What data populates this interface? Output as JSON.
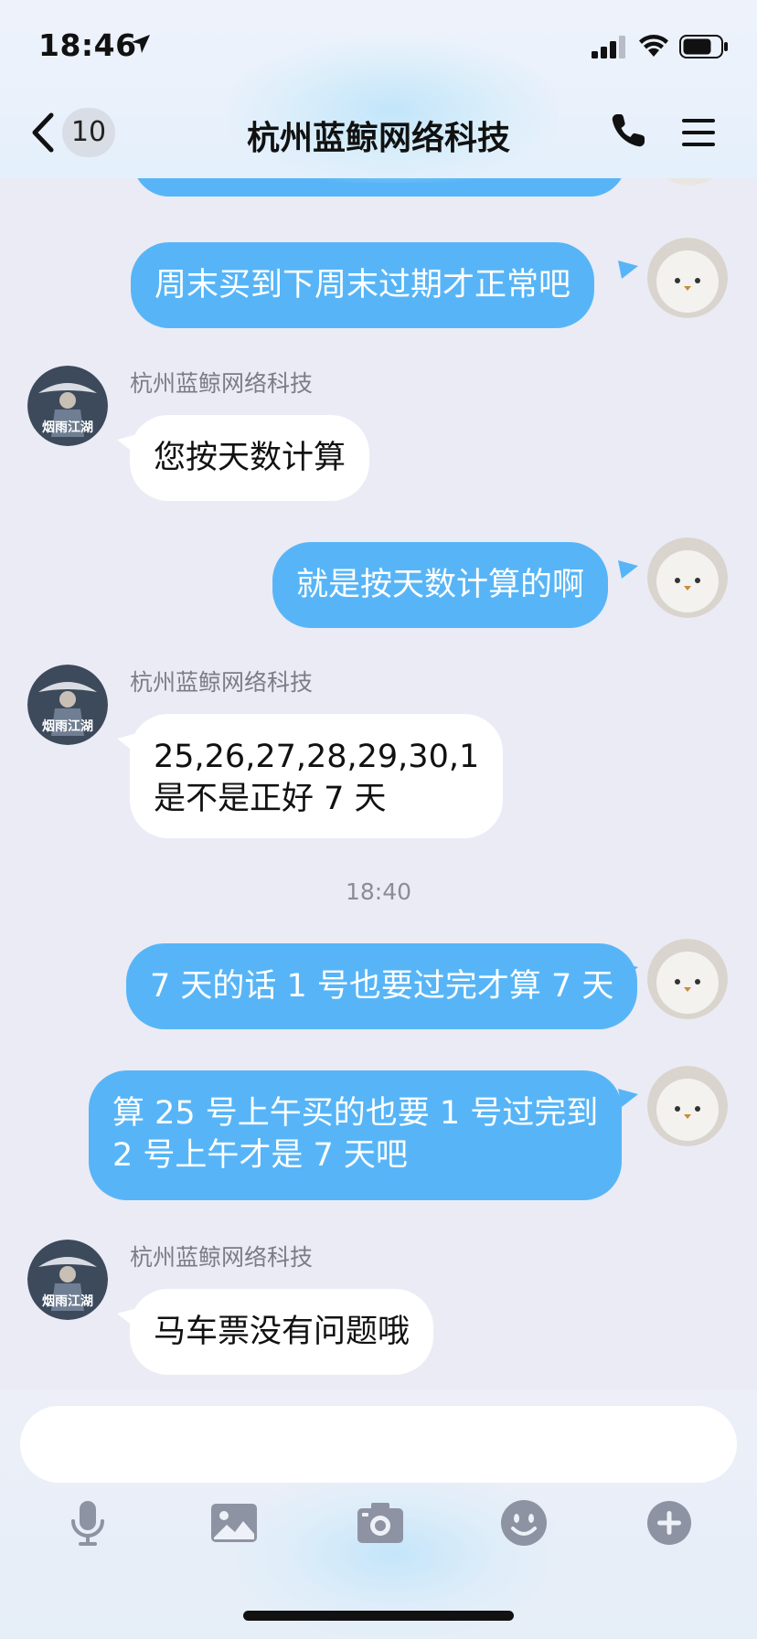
{
  "status_bar": {
    "time": "18:46"
  },
  "nav": {
    "badge_count": "10",
    "title": "杭州蓝鲸网络科技"
  },
  "messages": [
    {
      "direction": "out",
      "text": "周末买到下周末过期才正常吧"
    },
    {
      "direction": "in",
      "sender": "杭州蓝鲸网络科技",
      "text": "您按天数计算"
    },
    {
      "direction": "out",
      "text": "就是按天数计算的啊"
    },
    {
      "direction": "in",
      "sender": "杭州蓝鲸网络科技",
      "lines": [
        "25,26,27,28,29,30,1",
        "是不是正好 7 天"
      ]
    },
    {
      "timestamp": "18:40"
    },
    {
      "direction": "out",
      "text": "7 天的话 1 号也要过完才算 7 天"
    },
    {
      "direction": "out",
      "lines": [
        "算 25 号上午买的也要 1 号过完到",
        "2 号上午才是 7 天吧"
      ]
    },
    {
      "direction": "in",
      "sender": "杭州蓝鲸网络科技",
      "text": "马车票没有问题哦"
    }
  ],
  "input": {
    "value": "",
    "placeholder": ""
  },
  "toolbar": [
    "microphone-icon",
    "image-icon",
    "camera-icon",
    "emoji-icon",
    "plus-icon"
  ],
  "colors": {
    "outgoing_bubble": "#57b5f7",
    "incoming_bubble": "#ffffff",
    "background": "#ebebf5"
  }
}
